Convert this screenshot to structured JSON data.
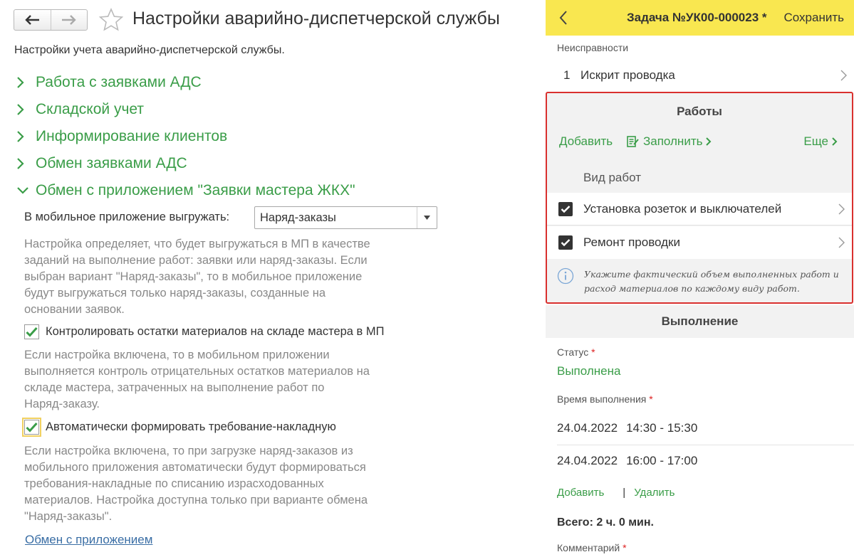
{
  "settings": {
    "title": "Настройки аварийно-диспетчерской службы",
    "subtitle": "Настройки учета аварийно-диспетчерской службы.",
    "sections": [
      {
        "label": "Работа с заявками АДС"
      },
      {
        "label": "Складской учет"
      },
      {
        "label": "Информирование клиентов"
      },
      {
        "label": "Обмен заявками АДС"
      },
      {
        "label": "Обмен с приложением \"Заявки мастера ЖКХ\""
      }
    ],
    "upload_label": "В мобильное приложение выгружать:",
    "upload_value": "Наряд-заказы",
    "upload_hint": [
      "Настройка определяет, что будет выгружаться в МП в качестве",
      "заданий на выполнение работ: заявки или наряд-заказы. Если",
      "выбран вариант \"Наряд-заказы\", то в мобильное приложение",
      "будут выгружаться только наряд-заказы, созданные на",
      "основании заявок."
    ],
    "control_label": "Контролировать остатки материалов на складе мастера в МП",
    "control_hint": [
      "Если настройка включена, то в мобильном приложении",
      "выполняется контроль отрицательных остатков материалов на",
      "складе мастера, затраченных на выполнение работ по",
      "Наряд-заказу."
    ],
    "auto_label": "Автоматически формировать требование-накладную",
    "auto_hint": [
      "Если настройка включена, то при загрузке наряд-заказов из",
      "мобильного приложения автоматически будут формироваться",
      "требования-накладные по списанию израсходованных",
      "материалов. Настройка доступна только при варианте обмена",
      "\"Наряд-заказы\"."
    ],
    "link": "Обмен с приложением"
  },
  "task": {
    "title": "Задача №УК00-000023 *",
    "save": "Сохранить",
    "faults_label": "Неисправности",
    "faults": [
      {
        "num": "1",
        "text": "Искрит проводка"
      }
    ],
    "works_title": "Работы",
    "add": "Добавить",
    "fill": "Заполнить",
    "more": "Еще",
    "works_col": "Вид работ",
    "works": [
      {
        "text": "Установка розеток и выключателей"
      },
      {
        "text": "Ремонт проводки"
      }
    ],
    "info": [
      "Укажите фактический объем выполненных работ и",
      "расход материалов по каждому виду работ."
    ],
    "exec_title": "Выполнение",
    "status_label": "Статус",
    "status_value": "Выполнена",
    "time_label": "Время выполнения",
    "times": [
      {
        "date": "24.04.2022",
        "range": "14:30 - 15:30"
      },
      {
        "date": "24.04.2022",
        "range": "16:00 - 17:00"
      }
    ],
    "add2": "Добавить",
    "bar": "|",
    "delete": "Удалить",
    "total": "Всего: 2 ч. 0 мин.",
    "comment_label": "Комментарий",
    "required_mark": "*"
  },
  "colors": {
    "accent_green": "#3a9d48",
    "header_yellow": "#f9e750",
    "highlight_red": "#d9302e",
    "link_blue": "#3a6ea5"
  }
}
